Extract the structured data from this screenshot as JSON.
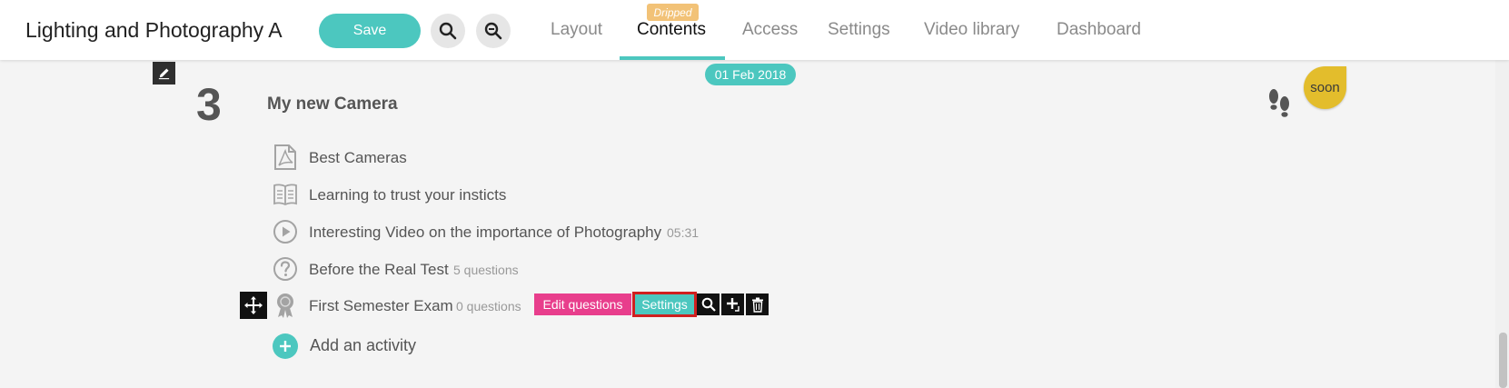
{
  "header": {
    "course_title": "Lighting and Photography A",
    "save_label": "Save",
    "tabs": [
      {
        "label": "Layout"
      },
      {
        "label": "Contents",
        "badge": "Dripped"
      },
      {
        "label": "Access"
      },
      {
        "label": "Settings"
      },
      {
        "label": "Video library"
      },
      {
        "label": "Dashboard"
      }
    ],
    "active_tab": "Contents"
  },
  "section": {
    "number": "3",
    "title": "My new Camera",
    "date": "01 Feb 2018",
    "soon_badge": "soon",
    "activities": [
      {
        "icon": "pdf-icon",
        "title": "Best Cameras"
      },
      {
        "icon": "book-icon",
        "title": "Learning to trust your insticts"
      },
      {
        "icon": "play-icon",
        "title": "Interesting Video on the importance of Photography",
        "meta": "05:31"
      },
      {
        "icon": "question-icon",
        "title": "Before the Real Test",
        "meta": "5 questions"
      },
      {
        "icon": "certificate-icon",
        "title": "First Semester Exam",
        "meta": "0 questions"
      }
    ],
    "exam_actions": {
      "edit_questions": "Edit questions",
      "settings": "Settings"
    },
    "add_activity": "Add an activity"
  },
  "colors": {
    "accent": "#4cc7bf",
    "pink": "#e83e8c",
    "highlight_border": "#d01f1f",
    "dripped": "#f2c277",
    "soon": "#e3bd2c"
  }
}
